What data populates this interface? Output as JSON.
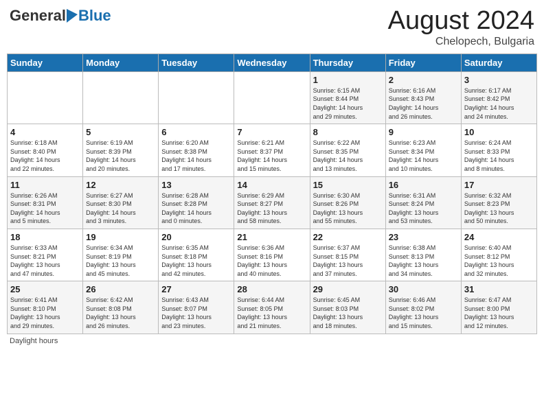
{
  "header": {
    "logo_general": "General",
    "logo_blue": "Blue",
    "month_title": "August 2024",
    "location": "Chelopech, Bulgaria"
  },
  "days_of_week": [
    "Sunday",
    "Monday",
    "Tuesday",
    "Wednesday",
    "Thursday",
    "Friday",
    "Saturday"
  ],
  "weeks": [
    [
      {
        "day": "",
        "info": ""
      },
      {
        "day": "",
        "info": ""
      },
      {
        "day": "",
        "info": ""
      },
      {
        "day": "",
        "info": ""
      },
      {
        "day": "1",
        "info": "Sunrise: 6:15 AM\nSunset: 8:44 PM\nDaylight: 14 hours\nand 29 minutes."
      },
      {
        "day": "2",
        "info": "Sunrise: 6:16 AM\nSunset: 8:43 PM\nDaylight: 14 hours\nand 26 minutes."
      },
      {
        "day": "3",
        "info": "Sunrise: 6:17 AM\nSunset: 8:42 PM\nDaylight: 14 hours\nand 24 minutes."
      }
    ],
    [
      {
        "day": "4",
        "info": "Sunrise: 6:18 AM\nSunset: 8:40 PM\nDaylight: 14 hours\nand 22 minutes."
      },
      {
        "day": "5",
        "info": "Sunrise: 6:19 AM\nSunset: 8:39 PM\nDaylight: 14 hours\nand 20 minutes."
      },
      {
        "day": "6",
        "info": "Sunrise: 6:20 AM\nSunset: 8:38 PM\nDaylight: 14 hours\nand 17 minutes."
      },
      {
        "day": "7",
        "info": "Sunrise: 6:21 AM\nSunset: 8:37 PM\nDaylight: 14 hours\nand 15 minutes."
      },
      {
        "day": "8",
        "info": "Sunrise: 6:22 AM\nSunset: 8:35 PM\nDaylight: 14 hours\nand 13 minutes."
      },
      {
        "day": "9",
        "info": "Sunrise: 6:23 AM\nSunset: 8:34 PM\nDaylight: 14 hours\nand 10 minutes."
      },
      {
        "day": "10",
        "info": "Sunrise: 6:24 AM\nSunset: 8:33 PM\nDaylight: 14 hours\nand 8 minutes."
      }
    ],
    [
      {
        "day": "11",
        "info": "Sunrise: 6:26 AM\nSunset: 8:31 PM\nDaylight: 14 hours\nand 5 minutes."
      },
      {
        "day": "12",
        "info": "Sunrise: 6:27 AM\nSunset: 8:30 PM\nDaylight: 14 hours\nand 3 minutes."
      },
      {
        "day": "13",
        "info": "Sunrise: 6:28 AM\nSunset: 8:28 PM\nDaylight: 14 hours\nand 0 minutes."
      },
      {
        "day": "14",
        "info": "Sunrise: 6:29 AM\nSunset: 8:27 PM\nDaylight: 13 hours\nand 58 minutes."
      },
      {
        "day": "15",
        "info": "Sunrise: 6:30 AM\nSunset: 8:26 PM\nDaylight: 13 hours\nand 55 minutes."
      },
      {
        "day": "16",
        "info": "Sunrise: 6:31 AM\nSunset: 8:24 PM\nDaylight: 13 hours\nand 53 minutes."
      },
      {
        "day": "17",
        "info": "Sunrise: 6:32 AM\nSunset: 8:23 PM\nDaylight: 13 hours\nand 50 minutes."
      }
    ],
    [
      {
        "day": "18",
        "info": "Sunrise: 6:33 AM\nSunset: 8:21 PM\nDaylight: 13 hours\nand 47 minutes."
      },
      {
        "day": "19",
        "info": "Sunrise: 6:34 AM\nSunset: 8:19 PM\nDaylight: 13 hours\nand 45 minutes."
      },
      {
        "day": "20",
        "info": "Sunrise: 6:35 AM\nSunset: 8:18 PM\nDaylight: 13 hours\nand 42 minutes."
      },
      {
        "day": "21",
        "info": "Sunrise: 6:36 AM\nSunset: 8:16 PM\nDaylight: 13 hours\nand 40 minutes."
      },
      {
        "day": "22",
        "info": "Sunrise: 6:37 AM\nSunset: 8:15 PM\nDaylight: 13 hours\nand 37 minutes."
      },
      {
        "day": "23",
        "info": "Sunrise: 6:38 AM\nSunset: 8:13 PM\nDaylight: 13 hours\nand 34 minutes."
      },
      {
        "day": "24",
        "info": "Sunrise: 6:40 AM\nSunset: 8:12 PM\nDaylight: 13 hours\nand 32 minutes."
      }
    ],
    [
      {
        "day": "25",
        "info": "Sunrise: 6:41 AM\nSunset: 8:10 PM\nDaylight: 13 hours\nand 29 minutes."
      },
      {
        "day": "26",
        "info": "Sunrise: 6:42 AM\nSunset: 8:08 PM\nDaylight: 13 hours\nand 26 minutes."
      },
      {
        "day": "27",
        "info": "Sunrise: 6:43 AM\nSunset: 8:07 PM\nDaylight: 13 hours\nand 23 minutes."
      },
      {
        "day": "28",
        "info": "Sunrise: 6:44 AM\nSunset: 8:05 PM\nDaylight: 13 hours\nand 21 minutes."
      },
      {
        "day": "29",
        "info": "Sunrise: 6:45 AM\nSunset: 8:03 PM\nDaylight: 13 hours\nand 18 minutes."
      },
      {
        "day": "30",
        "info": "Sunrise: 6:46 AM\nSunset: 8:02 PM\nDaylight: 13 hours\nand 15 minutes."
      },
      {
        "day": "31",
        "info": "Sunrise: 6:47 AM\nSunset: 8:00 PM\nDaylight: 13 hours\nand 12 minutes."
      }
    ]
  ],
  "footnote": "Daylight hours"
}
